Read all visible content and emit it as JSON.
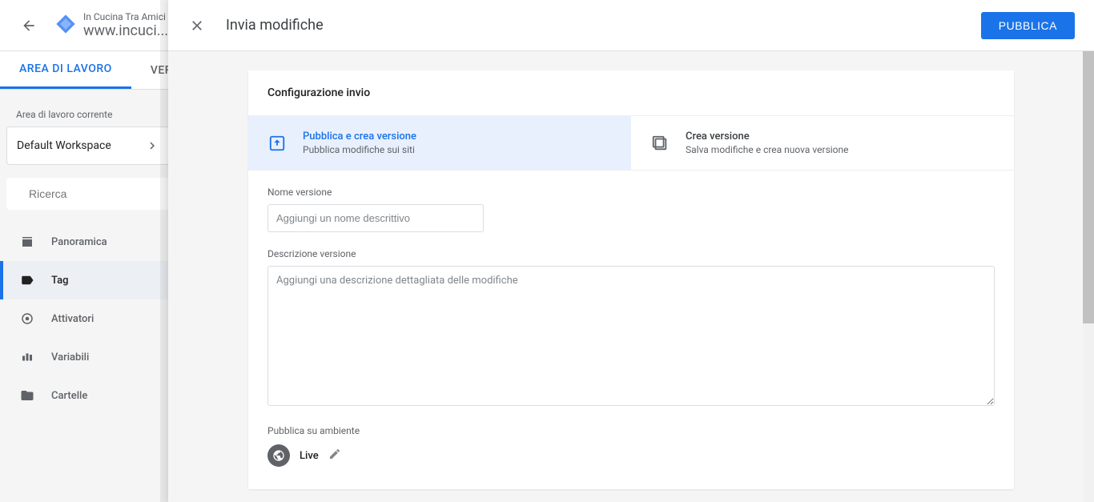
{
  "header": {
    "subtitle": "In Cucina Tra Amici",
    "title": "www.incuci..."
  },
  "tabs": {
    "workspace": "AREA DI LAVORO",
    "versions": "VER"
  },
  "sidebar": {
    "currentLabel": "Area di lavoro corrente",
    "workspace": "Default Workspace",
    "searchPlaceholder": "Ricerca",
    "nav": {
      "overview": "Panoramica",
      "tag": "Tag",
      "triggers": "Attivatori",
      "variables": "Variabili",
      "folders": "Cartelle"
    }
  },
  "modal": {
    "title": "Invia modifiche",
    "publishBtn": "PUBBLICA",
    "cardTitle": "Configurazione invio",
    "options": {
      "publish": {
        "title": "Pubblica e crea versione",
        "sub": "Pubblica modifiche sui siti"
      },
      "create": {
        "title": "Crea versione",
        "sub": "Salva modifiche e crea nuova versione"
      }
    },
    "form": {
      "nameLabel": "Nome versione",
      "namePlaceholder": "Aggiungi un nome descrittivo",
      "descLabel": "Descrizione versione",
      "descPlaceholder": "Aggiungi una descrizione dettagliata delle modifiche",
      "envLabel": "Pubblica su ambiente",
      "envValue": "Live"
    }
  }
}
